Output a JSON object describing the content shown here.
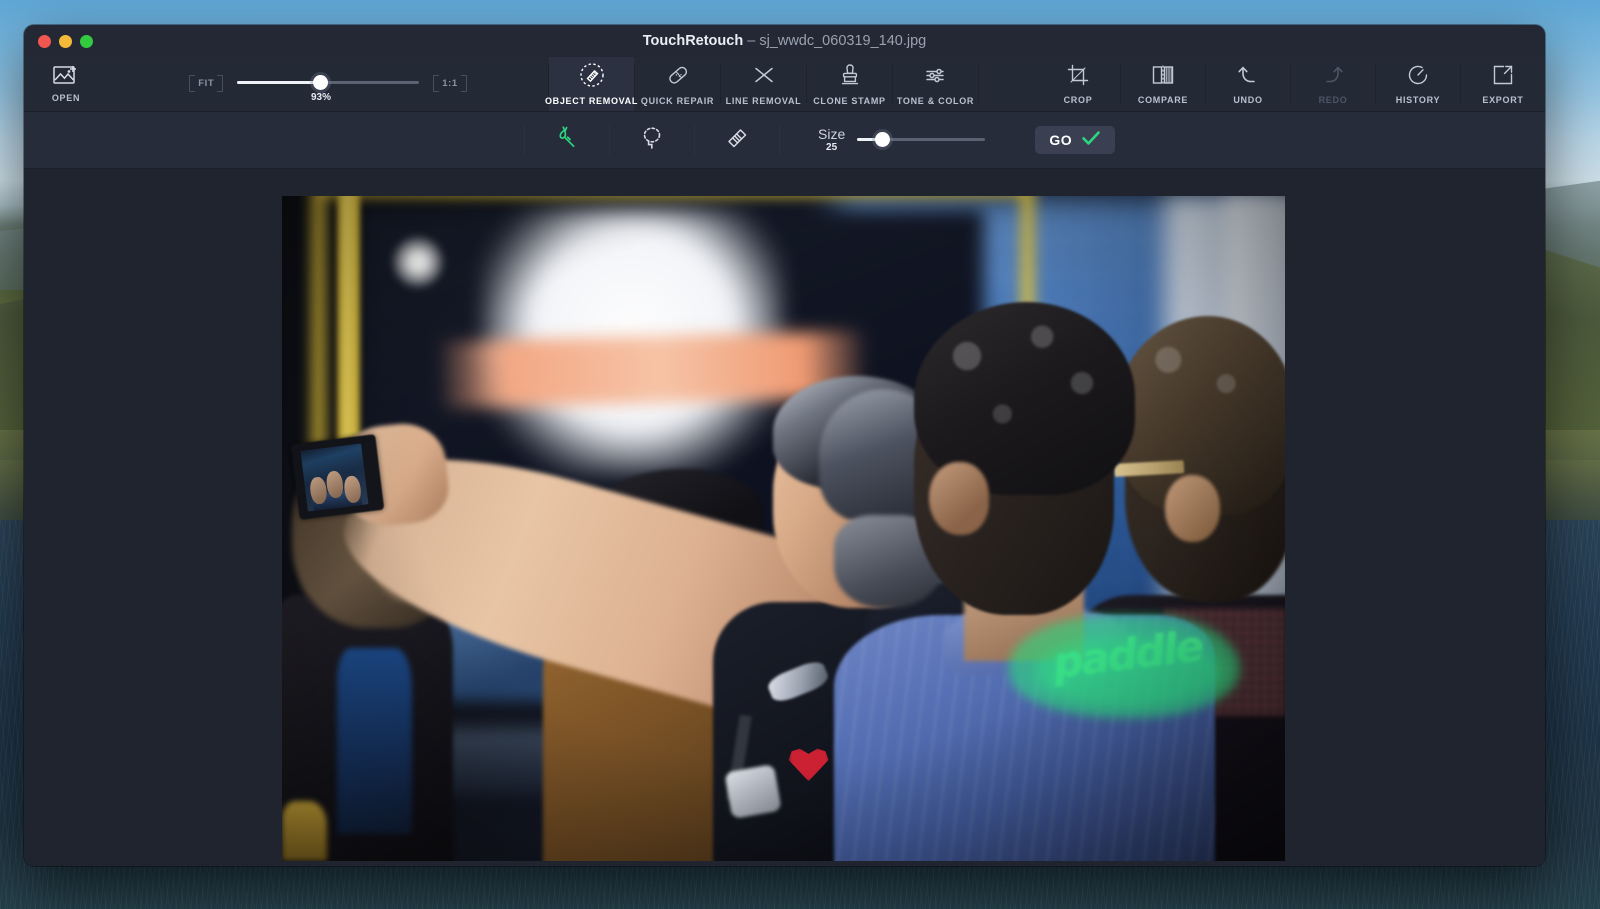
{
  "window": {
    "app_name": "TouchRetouch",
    "separator": " – ",
    "file_name": "sj_wwdc_060319_140.jpg",
    "traffic_lights": [
      "close-button",
      "minimize-button",
      "zoom-button"
    ]
  },
  "toolbar": {
    "open": {
      "label": "OPEN",
      "icon": "image-add-icon"
    },
    "zoom": {
      "fit_label": "FIT",
      "one_to_one_label": "1:1",
      "value_label": "93%",
      "value": 93,
      "thumb_percent": 46
    },
    "tools": [
      {
        "label": "OBJECT REMOVAL",
        "icon": "object-removal-icon",
        "active": true,
        "enabled": true
      },
      {
        "label": "QUICK REPAIR",
        "icon": "bandage-icon",
        "active": false,
        "enabled": true
      },
      {
        "label": "LINE REMOVAL",
        "icon": "cross-lines-icon",
        "active": false,
        "enabled": true
      },
      {
        "label": "CLONE STAMP",
        "icon": "stamp-icon",
        "active": false,
        "enabled": true
      },
      {
        "label": "TONE & COLOR",
        "icon": "sliders-icon",
        "active": false,
        "enabled": true
      }
    ],
    "actions": [
      {
        "label": "CROP",
        "icon": "crop-icon",
        "enabled": true
      },
      {
        "label": "COMPARE",
        "icon": "compare-icon",
        "enabled": true
      },
      {
        "label": "UNDO",
        "icon": "undo-arrow-icon",
        "enabled": true
      },
      {
        "label": "REDO",
        "icon": "redo-arrow-icon",
        "enabled": false
      },
      {
        "label": "HISTORY",
        "icon": "history-icon",
        "enabled": true
      },
      {
        "label": "EXPORT",
        "icon": "export-icon",
        "enabled": true
      }
    ]
  },
  "subbar": {
    "modes": [
      {
        "name": "brush-tool",
        "icon": "brush-icon",
        "active": true
      },
      {
        "name": "lasso-tool",
        "icon": "lasso-icon",
        "active": false
      },
      {
        "name": "eraser-tool",
        "icon": "eraser-icon",
        "active": false
      }
    ],
    "size": {
      "label": "Size",
      "value": "25",
      "thumb_percent": 20
    },
    "go_button": {
      "label": "GO",
      "icon": "check-icon"
    }
  },
  "canvas": {
    "photo_alt": "Three men in profile at a conference, one taking a selfie with a phone in the foreground, blurred yellow-framed sign in background",
    "mask_word": "paddle"
  },
  "colors": {
    "accent_green": "#2cd680",
    "window_chrome": "#262b38",
    "toolbar": "#242936",
    "canvas_bg": "#20242f",
    "active_tab": "#2b3141",
    "text_primary": "#e9edf4",
    "text_secondary": "#9aa2b1",
    "text_disabled": "#4d5566",
    "traffic_red": "#f2574f",
    "traffic_yellow": "#f5b93a",
    "traffic_green": "#32ca3f"
  }
}
